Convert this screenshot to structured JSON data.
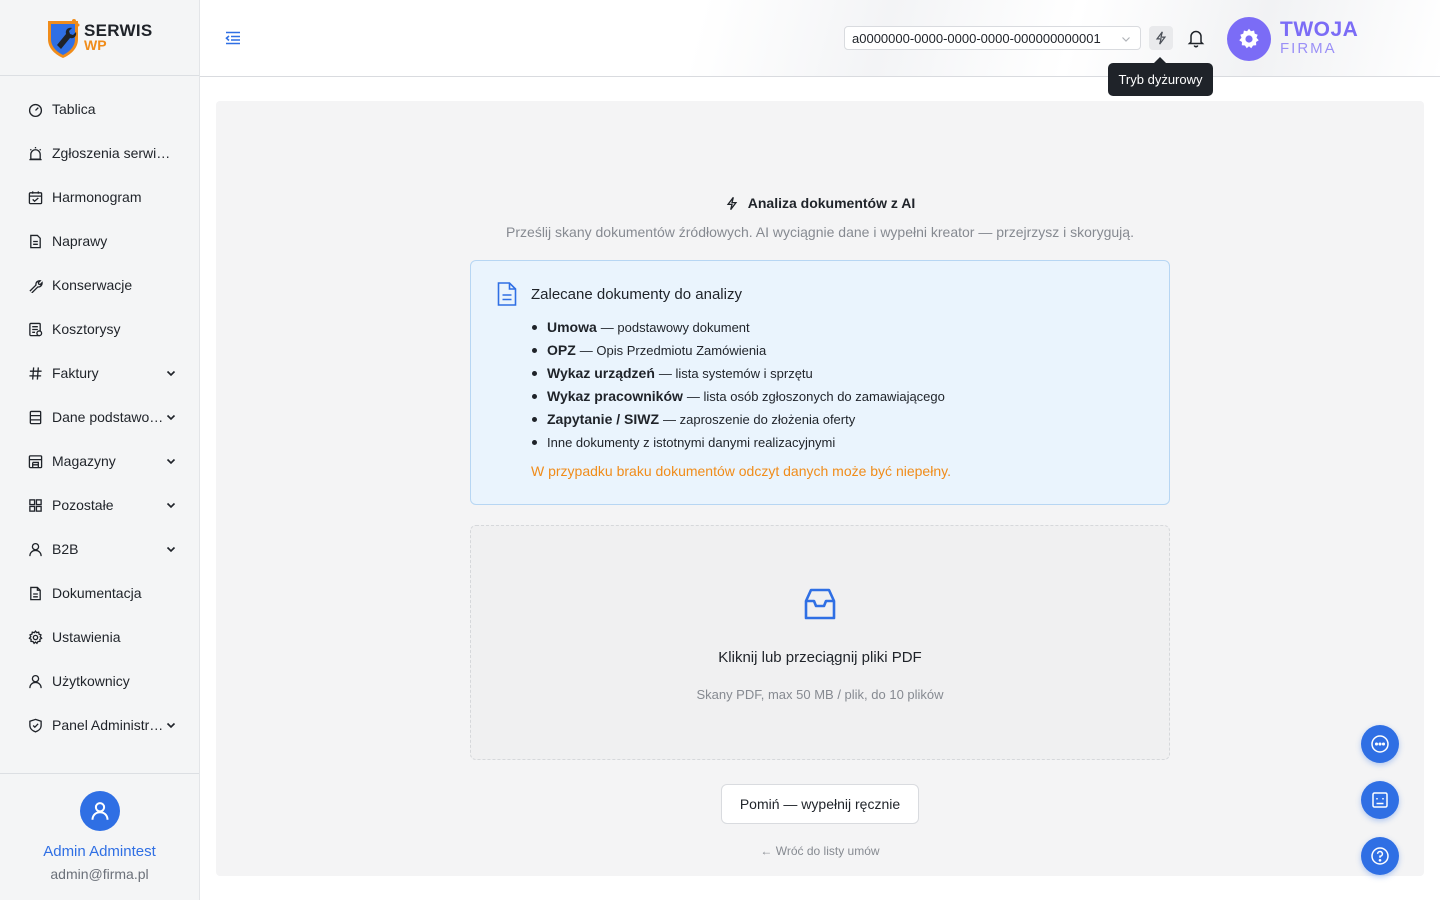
{
  "brand": {
    "line1": "SERWIS",
    "line2": "WP"
  },
  "sidebar": {
    "items": [
      {
        "label": "Tablica",
        "icon": "dashboard-icon",
        "expandable": false
      },
      {
        "label": "Zgłoszenia serwisowe",
        "icon": "alarm-icon",
        "expandable": false
      },
      {
        "label": "Harmonogram",
        "icon": "calendar-icon",
        "expandable": false
      },
      {
        "label": "Naprawy",
        "icon": "document-icon",
        "expandable": false
      },
      {
        "label": "Konserwacje",
        "icon": "wrench-icon",
        "expandable": false
      },
      {
        "label": "Kosztorysy",
        "icon": "estimate-icon",
        "expandable": false
      },
      {
        "label": "Faktury",
        "icon": "hash-icon",
        "expandable": true
      },
      {
        "label": "Dane podstawowe",
        "icon": "database-icon",
        "expandable": true
      },
      {
        "label": "Magazyny",
        "icon": "warehouse-icon",
        "expandable": true
      },
      {
        "label": "Pozostałe",
        "icon": "grid-icon",
        "expandable": true
      },
      {
        "label": "B2B",
        "icon": "user-icon",
        "expandable": true
      },
      {
        "label": "Dokumentacja",
        "icon": "file-icon",
        "expandable": false
      },
      {
        "label": "Ustawienia",
        "icon": "gear-icon",
        "expandable": false
      },
      {
        "label": "Użytkownicy",
        "icon": "users-icon",
        "expandable": false
      },
      {
        "label": "Panel Administratora",
        "icon": "shield-icon",
        "expandable": true
      }
    ]
  },
  "user": {
    "name": "Admin Admintest",
    "email": "admin@firma.pl"
  },
  "header": {
    "tenant_value": "a0000000-0000-0000-0000-000000000001",
    "duty_tooltip": "Tryb dyżurowy",
    "company_line1": "TWOJA",
    "company_line2": "FIRMA"
  },
  "main": {
    "title": "Analiza dokumentów z AI",
    "subtitle": "Prześlij skany dokumentów źródłowych. AI wyciągnie dane i wypełni kreator — przejrzysz i skorygują.",
    "info": {
      "title": "Zalecane dokumenty do analizy",
      "items": [
        {
          "bold": "Umowa",
          "text": "— podstawowy dokument"
        },
        {
          "bold": "OPZ",
          "text": "— Opis Przedmiotu Zamówienia"
        },
        {
          "bold": "Wykaz urządzeń",
          "text": "— lista systemów i sprzętu"
        },
        {
          "bold": "Wykaz pracowników",
          "text": "— lista osób zgłoszonych do zamawiającego"
        },
        {
          "bold": "Zapytanie / SIWZ",
          "text": "— zaproszenie do złożenia oferty"
        },
        {
          "bold": "",
          "text": "Inne dokumenty z istotnymi danymi realizacyjnymi"
        }
      ],
      "warning": "W przypadku braku dokumentów odczyt danych może być niepełny."
    },
    "dropzone": {
      "title": "Kliknij lub przeciągnij pliki PDF",
      "subtitle": "Skany PDF, max 50 MB / plik, do 10 plików"
    },
    "skip_label": "Pomiń — wypełnij ręcznie",
    "back_label": "← Wróć do listy umów"
  },
  "fabs": [
    {
      "icon": "chat-icon"
    },
    {
      "icon": "assistant-icon"
    },
    {
      "icon": "help-icon"
    }
  ],
  "colors": {
    "accent": "#2f6fe4",
    "brand_orange": "#f08c1a",
    "company_purple": "#7b6cf6",
    "info_bg": "#eaf4fd"
  }
}
